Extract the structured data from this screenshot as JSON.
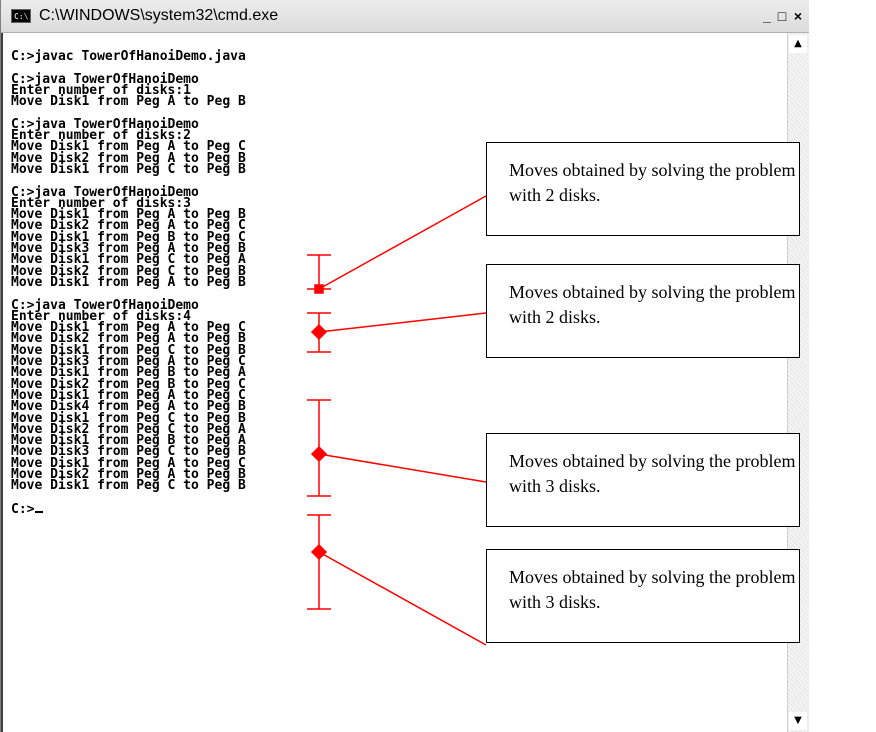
{
  "window": {
    "title": "C:\\WINDOWS\\system32\\cmd.exe",
    "icon": "cmd-app-icon",
    "icon_text": "C:\\",
    "minimize_label": "_",
    "maximize_label": "□",
    "close_label": "×"
  },
  "console": {
    "lines": [
      "C:>javac TowerOfHanoiDemo.java",
      "",
      "C:>java TowerOfHanoiDemo",
      "Enter number of disks:1",
      "Move Disk1 from Peg A to Peg B",
      "",
      "C:>java TowerOfHanoiDemo",
      "Enter number of disks:2",
      "Move Disk1 from Peg A to Peg C",
      "Move Disk2 from Peg A to Peg B",
      "Move Disk1 from Peg C to Peg B",
      "",
      "C:>java TowerOfHanoiDemo",
      "Enter number of disks:3",
      "Move Disk1 from Peg A to Peg B",
      "Move Disk2 from Peg A to Peg C",
      "Move Disk1 from Peg B to Peg C",
      "Move Disk3 from Peg A to Peg B",
      "Move Disk1 from Peg C to Peg A",
      "Move Disk2 from Peg C to Peg B",
      "Move Disk1 from Peg A to Peg B",
      "",
      "C:>java TowerOfHanoiDemo",
      "Enter number of disks:4",
      "Move Disk1 from Peg A to Peg C",
      "Move Disk2 from Peg A to Peg B",
      "Move Disk1 from Peg C to Peg B",
      "Move Disk3 from Peg A to Peg C",
      "Move Disk1 from Peg B to Peg A",
      "Move Disk2 from Peg B to Peg C",
      "Move Disk1 from Peg A to Peg C",
      "Move Disk4 from Peg A to Peg B",
      "Move Disk1 from Peg C to Peg B",
      "Move Disk2 from Peg C to Peg A",
      "Move Disk1 from Peg B to Peg A",
      "Move Disk3 from Peg C to Peg B",
      "Move Disk1 from Peg A to Peg C",
      "Move Disk2 from Peg A to Peg B",
      "Move Disk1 from Peg C to Peg B",
      "",
      "C:>"
    ]
  },
  "callouts": [
    "Moves obtained by solving the problem with 2 disks.",
    "Moves obtained by solving the problem with 2 disks.",
    "Moves obtained by solving the problem with 3 disks.",
    "Moves obtained by solving the problem with 3 disks."
  ],
  "colors": {
    "annotation": "#ff0000",
    "console_text": "#000000",
    "console_background": "#ffffff"
  }
}
